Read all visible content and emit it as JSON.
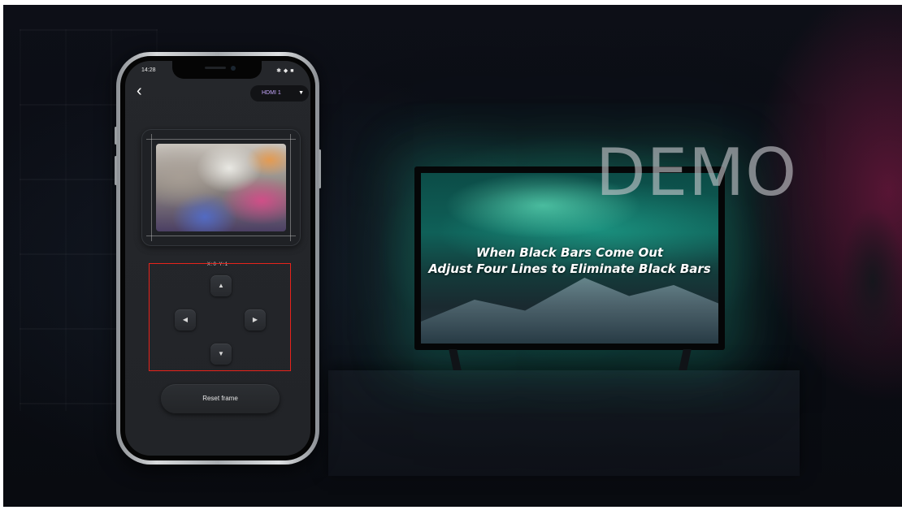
{
  "video": {
    "watermark": "DEMO",
    "tv_caption": {
      "line1": "When Black Bars Come Out",
      "line2": "Adjust Four Lines to Eliminate Black Bars"
    }
  },
  "phone_app": {
    "status_bar": {
      "time": "14:28",
      "icons": "✱ ◆ ■"
    },
    "header": {
      "back_icon": "chevron-left-icon",
      "source_selected": "HDMI 1"
    },
    "adjust_panel": {
      "label": "X:0 Y:1",
      "buttons": [
        {
          "direction": "up",
          "icon": "triangle-up-icon"
        },
        {
          "direction": "left",
          "icon": "triangle-left-icon"
        },
        {
          "direction": "right",
          "icon": "triangle-right-icon"
        },
        {
          "direction": "down",
          "icon": "triangle-down-icon"
        }
      ]
    },
    "reset_button": "Reset frame"
  },
  "colors": {
    "accent_source": "#c7a8ff",
    "highlight_box": "#e8231b",
    "tv_glow": "#1eaa8c"
  }
}
